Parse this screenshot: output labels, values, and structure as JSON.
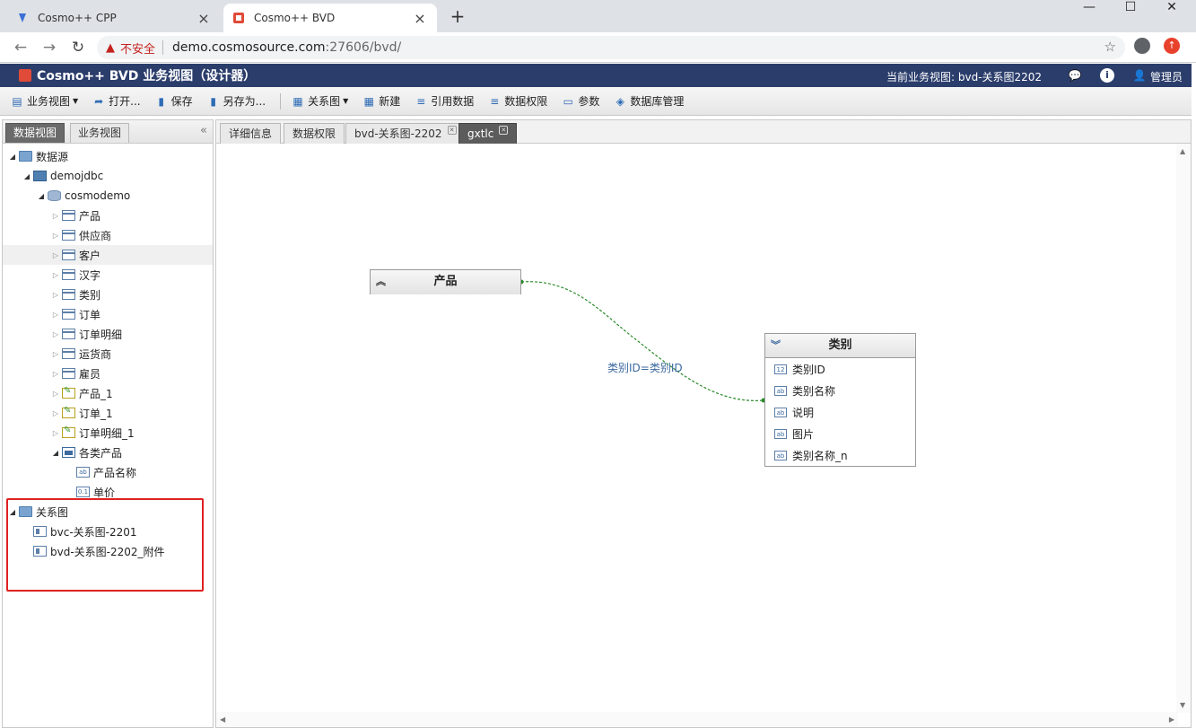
{
  "browser": {
    "tabs": [
      {
        "title": "Cosmo++ CPP",
        "active": false
      },
      {
        "title": "Cosmo++ BVD",
        "active": true
      }
    ],
    "new_tab": "+",
    "window": {
      "minimize": "—",
      "maximize": "☐",
      "close": "✕"
    },
    "address": {
      "security_label": "不安全",
      "host": "demo.cosmosource.com",
      "path": ":27606/bvd/"
    }
  },
  "app": {
    "title": "Cosmo++ BVD 业务视图（设计器）",
    "current_view_label": "当前业务视图: bvd-关系图2202",
    "user": "管理员",
    "colors": {
      "header_bg": "#2b3d6b",
      "logo": "#e04a38",
      "highlight_box": "#e02020",
      "relation_line": "#2a8a2a"
    }
  },
  "toolbar": {
    "items": [
      {
        "label": "业务视图",
        "icon": "view-icon",
        "dropdown": true
      },
      {
        "label": "打开...",
        "icon": "open-icon",
        "dropdown": false
      },
      {
        "label": "保存",
        "icon": "save-icon",
        "dropdown": false
      },
      {
        "label": "另存为...",
        "icon": "save-as-icon",
        "dropdown": false
      },
      {
        "label": "关系图",
        "icon": "diagram-icon",
        "dropdown": true
      },
      {
        "label": "新建",
        "icon": "new-icon",
        "dropdown": false
      },
      {
        "label": "引用数据",
        "icon": "reference-data-icon",
        "dropdown": false
      },
      {
        "label": "数据权限",
        "icon": "data-permission-icon",
        "dropdown": false
      },
      {
        "label": "参数",
        "icon": "parameter-icon",
        "dropdown": false
      },
      {
        "label": "数据库管理",
        "icon": "database-manage-icon",
        "dropdown": false
      }
    ]
  },
  "left_panel": {
    "tabs": [
      {
        "label": "数据视图",
        "selected": true
      },
      {
        "label": "业务视图",
        "selected": false
      }
    ],
    "tree": [
      {
        "label": "数据源",
        "depth": 0,
        "icon": "folder",
        "expanded": true
      },
      {
        "label": "demojdbc",
        "depth": 1,
        "icon": "server",
        "expanded": true
      },
      {
        "label": "cosmodemo",
        "depth": 2,
        "icon": "db",
        "expanded": true
      },
      {
        "label": "产品",
        "depth": 3,
        "icon": "table",
        "expanded": false
      },
      {
        "label": "供应商",
        "depth": 3,
        "icon": "table",
        "expanded": false
      },
      {
        "label": "客户",
        "depth": 3,
        "icon": "table",
        "expanded": false,
        "hover": true
      },
      {
        "label": "汉字",
        "depth": 3,
        "icon": "table",
        "expanded": false
      },
      {
        "label": "类别",
        "depth": 3,
        "icon": "table",
        "expanded": false
      },
      {
        "label": "订单",
        "depth": 3,
        "icon": "table",
        "expanded": false
      },
      {
        "label": "订单明细",
        "depth": 3,
        "icon": "table",
        "expanded": false
      },
      {
        "label": "运货商",
        "depth": 3,
        "icon": "table",
        "expanded": false
      },
      {
        "label": "雇员",
        "depth": 3,
        "icon": "table",
        "expanded": false
      },
      {
        "label": "产品_1",
        "depth": 3,
        "icon": "sql",
        "expanded": false
      },
      {
        "label": "订单_1",
        "depth": 3,
        "icon": "sql",
        "expanded": false
      },
      {
        "label": "订单明细_1",
        "depth": 3,
        "icon": "sql",
        "expanded": false
      },
      {
        "label": "各类产品",
        "depth": 3,
        "icon": "view",
        "expanded": true
      },
      {
        "label": "产品名称",
        "depth": 4,
        "icon": "field",
        "glyph": "ab"
      },
      {
        "label": "单价",
        "depth": 4,
        "icon": "field",
        "glyph": "0.1"
      },
      {
        "label": "关系图",
        "depth": 0,
        "icon": "folder",
        "expanded": true
      },
      {
        "label": "bvc-关系图-2201",
        "depth": 1,
        "icon": "rel"
      },
      {
        "label": "bvd-关系图-2202_附件",
        "depth": 1,
        "icon": "rel"
      }
    ]
  },
  "main": {
    "tabs": [
      {
        "label": "详细信息",
        "closable": false,
        "selected": false
      },
      {
        "label": "数据权限",
        "closable": false,
        "selected": false
      },
      {
        "label": "bvd-关系图-2202",
        "closable": true,
        "selected": false
      },
      {
        "label": "gxtlc",
        "closable": true,
        "selected": true
      }
    ],
    "diagram": {
      "relation_label": "类别ID=类别ID",
      "entities": [
        {
          "name": "产品",
          "collapsed": true,
          "fields": []
        },
        {
          "name": "类别",
          "collapsed": false,
          "fields": [
            {
              "label": "类别ID",
              "glyph": "12"
            },
            {
              "label": "类别名称",
              "glyph": "ab"
            },
            {
              "label": "说明",
              "glyph": "ab"
            },
            {
              "label": "图片",
              "glyph": "ab"
            },
            {
              "label": "类别名称_n",
              "glyph": "ab"
            }
          ]
        }
      ]
    }
  }
}
